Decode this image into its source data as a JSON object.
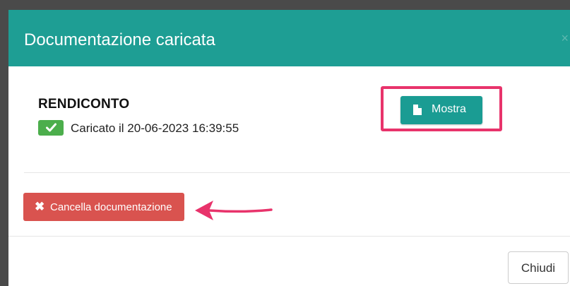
{
  "modal": {
    "title": "Documentazione caricata",
    "close_glyph": "×"
  },
  "document": {
    "name": "RENDICONTO",
    "status_text": "Caricato il 20-06-2023 16:39:55"
  },
  "actions": {
    "show_label": "Mostra",
    "delete_label": "Cancella documentazione",
    "delete_icon_glyph": "✖",
    "close_label": "Chiudi"
  },
  "icons": {
    "check": "check-icon",
    "file": "file-icon",
    "delete": "times-icon",
    "close": "close-icon"
  },
  "colors": {
    "header": "#1e9e94",
    "primary_button": "#1a9c93",
    "danger_button": "#d9534f",
    "success_badge": "#4cae4c",
    "annotation": "#e8336b"
  }
}
